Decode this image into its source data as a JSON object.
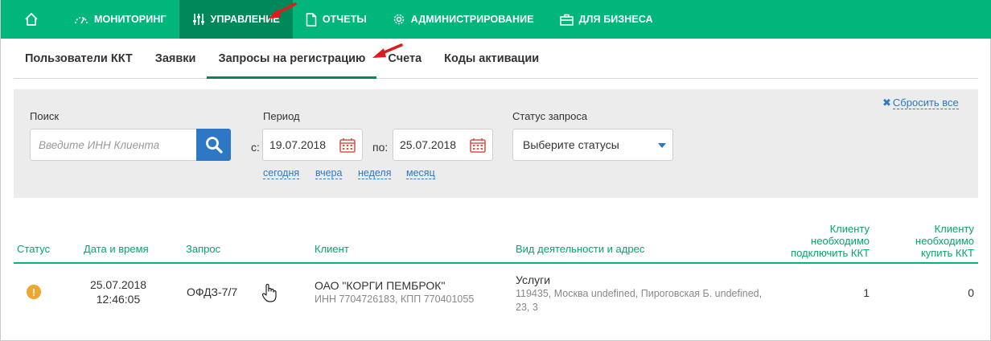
{
  "nav": {
    "items": [
      {
        "label": "МОНИТОРИНГ",
        "icon": "speedometer-icon"
      },
      {
        "label": "УПРАВЛЕНИЕ",
        "icon": "sliders-icon",
        "active": true
      },
      {
        "label": "ОТЧЕТЫ",
        "icon": "document-icon"
      },
      {
        "label": "АДМИНИСТРИРОВАНИЕ",
        "icon": "gear-icon"
      },
      {
        "label": "ДЛЯ БИЗНЕСА",
        "icon": "briefcase-icon"
      }
    ]
  },
  "subtabs": [
    {
      "label": "Пользователи ККТ"
    },
    {
      "label": "Заявки"
    },
    {
      "label": "Запросы на регистрацию",
      "active": true
    },
    {
      "label": "Счета"
    },
    {
      "label": "Коды активации"
    }
  ],
  "filter": {
    "search_label": "Поиск",
    "search_placeholder": "Введите ИНН Клиента",
    "period_label": "Период",
    "from_prefix": "с:",
    "from_value": "19.07.2018",
    "to_prefix": "по:",
    "to_value": "25.07.2018",
    "quick_links": [
      "сегодня",
      "вчера",
      "неделя",
      "месяц"
    ],
    "status_label": "Статус запроса",
    "status_value": "Выберите статусы",
    "reset_label": "Сбросить все"
  },
  "table": {
    "columns": {
      "status": "Статус",
      "datetime": "Дата и время",
      "request": "Запрос",
      "client": "Клиент",
      "activity": "Вид деятельности и адрес",
      "connect": [
        "Клиенту",
        "необходимо",
        "подключить ККТ"
      ],
      "buy": [
        "Клиенту",
        "необходимо",
        "купить ККТ"
      ]
    },
    "rows": [
      {
        "status_icon": "warning-icon",
        "date": "25.07.2018",
        "time": "12:46:05",
        "request": "ОФДЗ-7/7",
        "client_name": "ОАО \"КОРГИ ПЕМБРОК\"",
        "client_ids": "ИНН 7704726183, КПП 770401055",
        "activity": "Услуги",
        "address_line1": "119435, Москва undefined, Пироговская Б. undefined,",
        "address_line2": "23, 3",
        "connect": "1",
        "buy": "0"
      }
    ]
  },
  "colors": {
    "brand": "#00b67a",
    "brand_dark": "#00875a",
    "link": "#2e77c4",
    "warning": "#f0a52f",
    "arrow": "#e0191f"
  }
}
